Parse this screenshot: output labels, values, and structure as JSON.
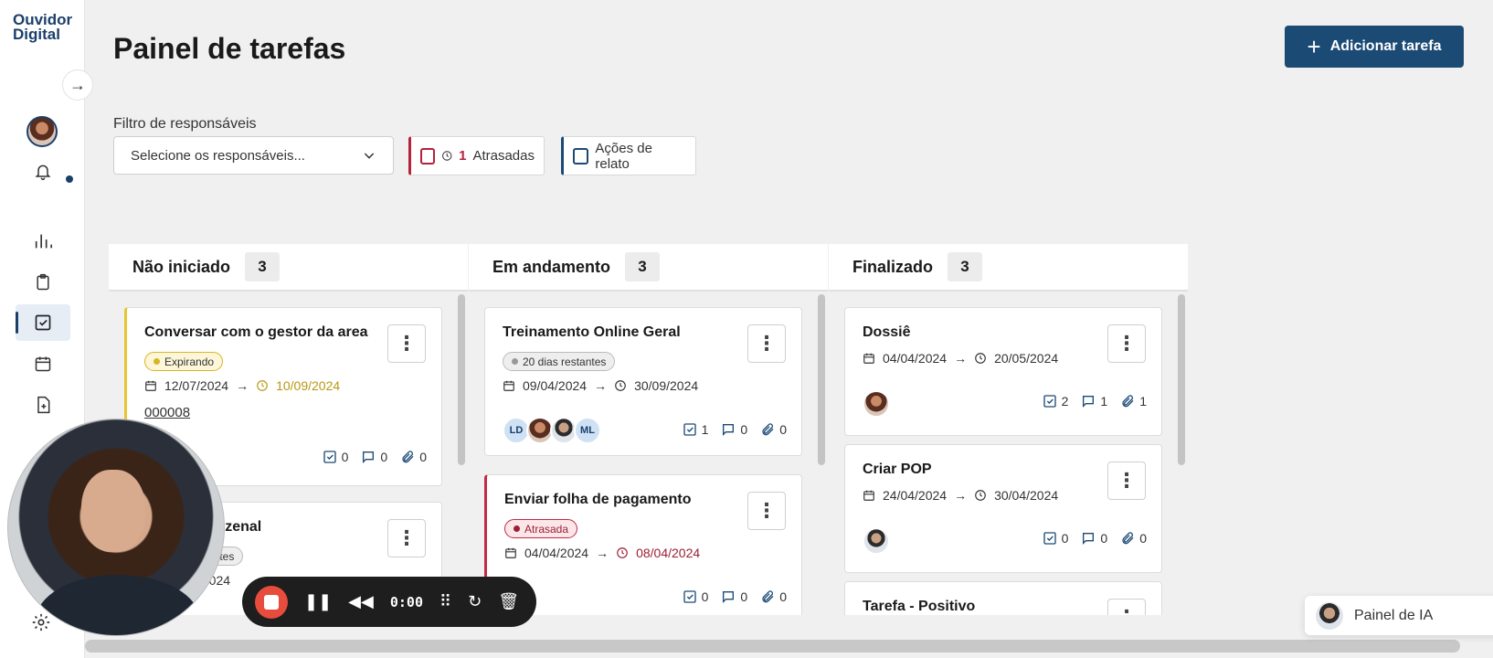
{
  "sidebar": {
    "logo_line1": "Ouvidor",
    "logo_line2": "Digital",
    "icons": [
      "bar-chart-icon",
      "clipboard-icon",
      "checkbox-icon",
      "calendar-icon",
      "file-add-icon",
      "gear-icon"
    ]
  },
  "header": {
    "title": "Painel de tarefas",
    "add_button": "Adicionar tarefa"
  },
  "filters": {
    "label": "Filtro de responsáveis",
    "select_placeholder": "Selecione os responsáveis...",
    "late_count": "1",
    "late_label": "Atrasadas",
    "report_label": "Ações de relato"
  },
  "columns": [
    {
      "title": "Não iniciado",
      "count": "3",
      "cards": [
        {
          "title": "Conversar com o gestor da area",
          "badge": "Expirando",
          "start": "12/07/2024",
          "due": "10/09/2024",
          "code": "000008",
          "checks": "0",
          "comments": "0",
          "attachments": "0"
        },
        {
          "title": "inzenal",
          "badge": "antes",
          "start": "/2024"
        }
      ]
    },
    {
      "title": "Em andamento",
      "count": "3",
      "cards": [
        {
          "title": "Treinamento Online Geral",
          "badge": "20 dias restantes",
          "start": "09/04/2024",
          "due": "30/09/2024",
          "avatars": [
            "LD",
            "",
            "",
            "ML"
          ],
          "checks": "1",
          "comments": "0",
          "attachments": "0"
        },
        {
          "title": "Enviar folha de pagamento",
          "badge": "Atrasada",
          "start": "04/04/2024",
          "due": "08/04/2024",
          "checks": "0",
          "comments": "0",
          "attachments": "0"
        }
      ]
    },
    {
      "title": "Finalizado",
      "count": "3",
      "cards": [
        {
          "title": "Dossiê",
          "start": "04/04/2024",
          "due": "20/05/2024",
          "checks": "2",
          "comments": "1",
          "attachments": "1"
        },
        {
          "title": "Criar POP",
          "start": "24/04/2024",
          "due": "30/04/2024",
          "checks": "0",
          "comments": "0",
          "attachments": "0"
        },
        {
          "title": "Tarefa - Positivo"
        }
      ]
    }
  ],
  "ia_panel": {
    "label": "Painel de IA"
  },
  "recorder": {
    "time": "0:00"
  },
  "colors": {
    "primary": "#1b4a75",
    "late": "#b5223c",
    "expiring": "#e8c42e"
  }
}
